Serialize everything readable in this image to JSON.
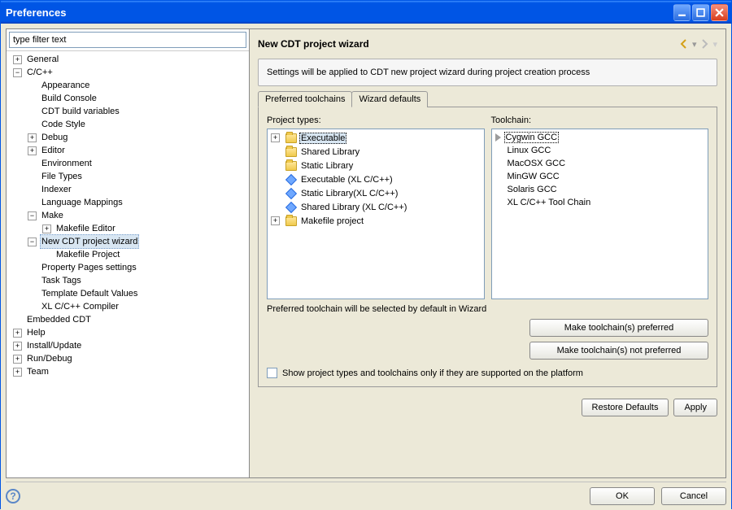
{
  "window": {
    "title": "Preferences"
  },
  "search": {
    "placeholder": "type filter text"
  },
  "tree": [
    {
      "label": "General",
      "depth": 0,
      "expand": "+",
      "selected": false
    },
    {
      "label": "C/C++",
      "depth": 0,
      "expand": "-",
      "selected": false
    },
    {
      "label": "Appearance",
      "depth": 1,
      "expand": "",
      "selected": false
    },
    {
      "label": "Build Console",
      "depth": 1,
      "expand": "",
      "selected": false
    },
    {
      "label": "CDT build variables",
      "depth": 1,
      "expand": "",
      "selected": false
    },
    {
      "label": "Code Style",
      "depth": 1,
      "expand": "",
      "selected": false
    },
    {
      "label": "Debug",
      "depth": 1,
      "expand": "+",
      "selected": false
    },
    {
      "label": "Editor",
      "depth": 1,
      "expand": "+",
      "selected": false
    },
    {
      "label": "Environment",
      "depth": 1,
      "expand": "",
      "selected": false
    },
    {
      "label": "File Types",
      "depth": 1,
      "expand": "",
      "selected": false
    },
    {
      "label": "Indexer",
      "depth": 1,
      "expand": "",
      "selected": false
    },
    {
      "label": "Language Mappings",
      "depth": 1,
      "expand": "",
      "selected": false
    },
    {
      "label": "Make",
      "depth": 1,
      "expand": "-",
      "selected": false
    },
    {
      "label": "Makefile Editor",
      "depth": 2,
      "expand": "+",
      "selected": false
    },
    {
      "label": "New CDT project wizard",
      "depth": 1,
      "expand": "-",
      "selected": true
    },
    {
      "label": "Makefile Project",
      "depth": 2,
      "expand": "",
      "selected": false
    },
    {
      "label": "Property Pages settings",
      "depth": 1,
      "expand": "",
      "selected": false
    },
    {
      "label": "Task Tags",
      "depth": 1,
      "expand": "",
      "selected": false
    },
    {
      "label": "Template Default Values",
      "depth": 1,
      "expand": "",
      "selected": false
    },
    {
      "label": "XL C/C++ Compiler",
      "depth": 1,
      "expand": "",
      "selected": false
    },
    {
      "label": "Embedded CDT",
      "depth": 0,
      "expand": "",
      "selected": false
    },
    {
      "label": "Help",
      "depth": 0,
      "expand": "+",
      "selected": false
    },
    {
      "label": "Install/Update",
      "depth": 0,
      "expand": "+",
      "selected": false
    },
    {
      "label": "Run/Debug",
      "depth": 0,
      "expand": "+",
      "selected": false
    },
    {
      "label": "Team",
      "depth": 0,
      "expand": "+",
      "selected": false
    }
  ],
  "page": {
    "title": "New CDT project wizard",
    "description": "Settings will be applied to CDT new project wizard during project creation process",
    "tabs": {
      "preferred": "Preferred toolchains",
      "defaults": "Wizard defaults"
    },
    "project_types_label": "Project types:",
    "toolchain_label": "Toolchain:",
    "project_types": [
      {
        "icon": "folder",
        "expand": "+",
        "label": "Executable",
        "selected": true
      },
      {
        "icon": "folder",
        "expand": "",
        "label": "Shared Library",
        "selected": false
      },
      {
        "icon": "folder",
        "expand": "",
        "label": "Static Library",
        "selected": false
      },
      {
        "icon": "diamond",
        "expand": "",
        "label": "Executable (XL C/C++)",
        "selected": false
      },
      {
        "icon": "diamond",
        "expand": "",
        "label": "Static Library(XL C/C++)",
        "selected": false
      },
      {
        "icon": "diamond",
        "expand": "",
        "label": "Shared Library (XL C/C++)",
        "selected": false
      },
      {
        "icon": "folder",
        "expand": "+",
        "label": "Makefile project",
        "selected": false
      }
    ],
    "toolchains": [
      {
        "label": "Cygwin GCC",
        "selected": true
      },
      {
        "label": "Linux GCC",
        "selected": false
      },
      {
        "label": "MacOSX GCC",
        "selected": false
      },
      {
        "label": "MinGW GCC",
        "selected": false
      },
      {
        "label": "Solaris GCC",
        "selected": false
      },
      {
        "label": "XL C/C++ Tool Chain",
        "selected": false
      }
    ],
    "hint": "Preferred toolchain will be selected by default in Wizard",
    "make_preferred": "Make toolchain(s) preferred",
    "make_not_preferred": "Make toolchain(s) not preferred",
    "supported_only": "Show project types and toolchains only if they are supported on the platform"
  },
  "footer": {
    "restore": "Restore Defaults",
    "apply": "Apply",
    "ok": "OK",
    "cancel": "Cancel"
  }
}
